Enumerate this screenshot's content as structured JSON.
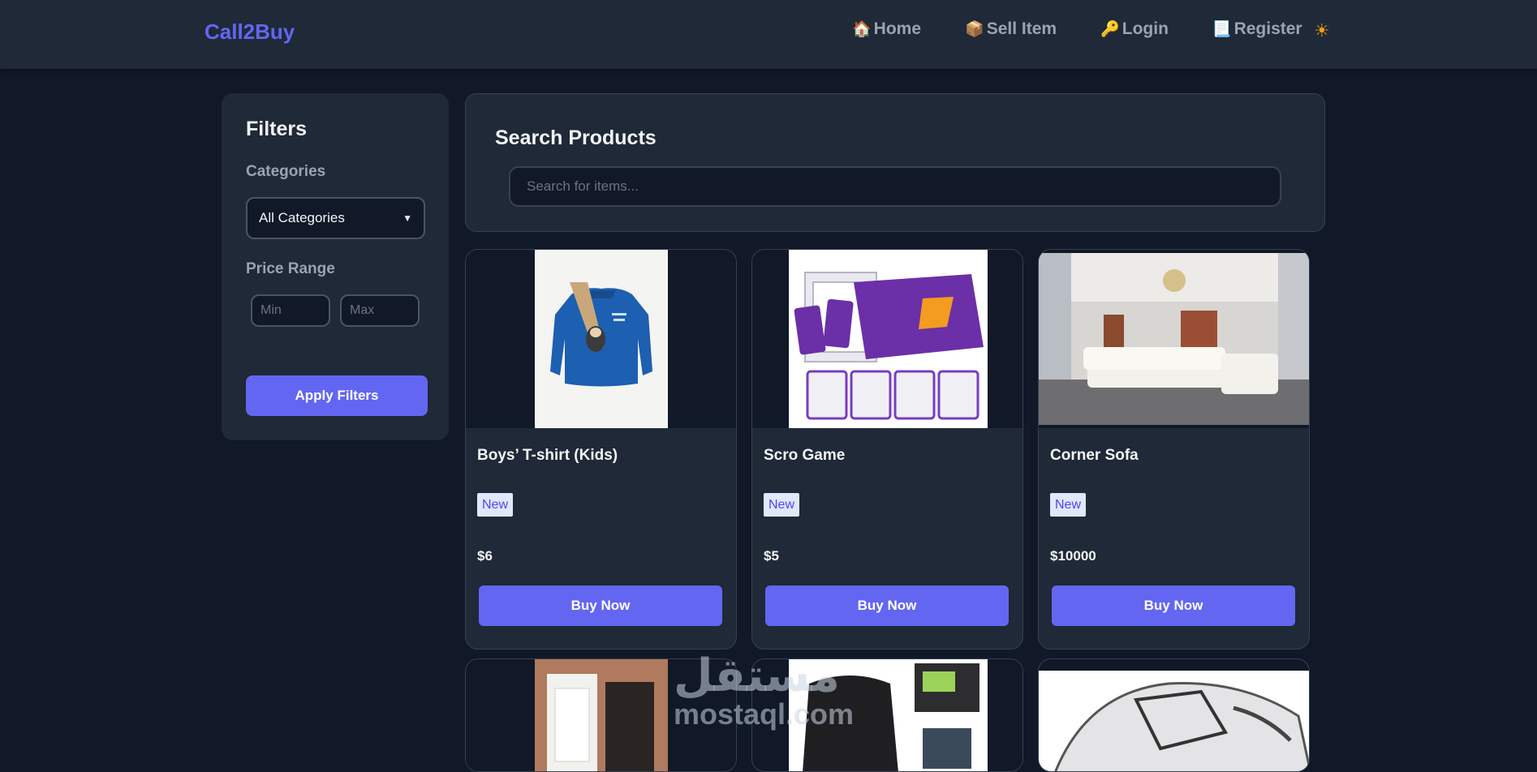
{
  "navbar": {
    "brand": "Call2Buy",
    "links": [
      {
        "icon": "🏠",
        "label": "Home"
      },
      {
        "icon": "📦",
        "label": "Sell Item"
      },
      {
        "icon": "🔑",
        "label": "Login"
      },
      {
        "icon": "📃",
        "label": "Register"
      }
    ],
    "theme_icon": "☀"
  },
  "sidebar": {
    "title": "Filters",
    "categories_label": "Categories",
    "category_selected": "All Categories",
    "price_label": "Price Range",
    "min_placeholder": "Min",
    "max_placeholder": "Max",
    "apply_label": "Apply Filters"
  },
  "search": {
    "title": "Search Products",
    "placeholder": "Search for items..."
  },
  "products": [
    {
      "name": "Boys’ T-shirt (Kids)",
      "condition": "New",
      "price": "$6",
      "buy_label": "Buy Now"
    },
    {
      "name": "Scro Game",
      "condition": "New",
      "price": "$5",
      "buy_label": "Buy Now"
    },
    {
      "name": "Corner Sofa",
      "condition": "New",
      "price": "$10000",
      "buy_label": "Buy Now"
    }
  ],
  "watermark": {
    "arabic": "مستقل",
    "latin": "mostaql.com"
  },
  "colors": {
    "accent": "#6366f1",
    "background": "#111827",
    "panel": "#1f2937"
  }
}
